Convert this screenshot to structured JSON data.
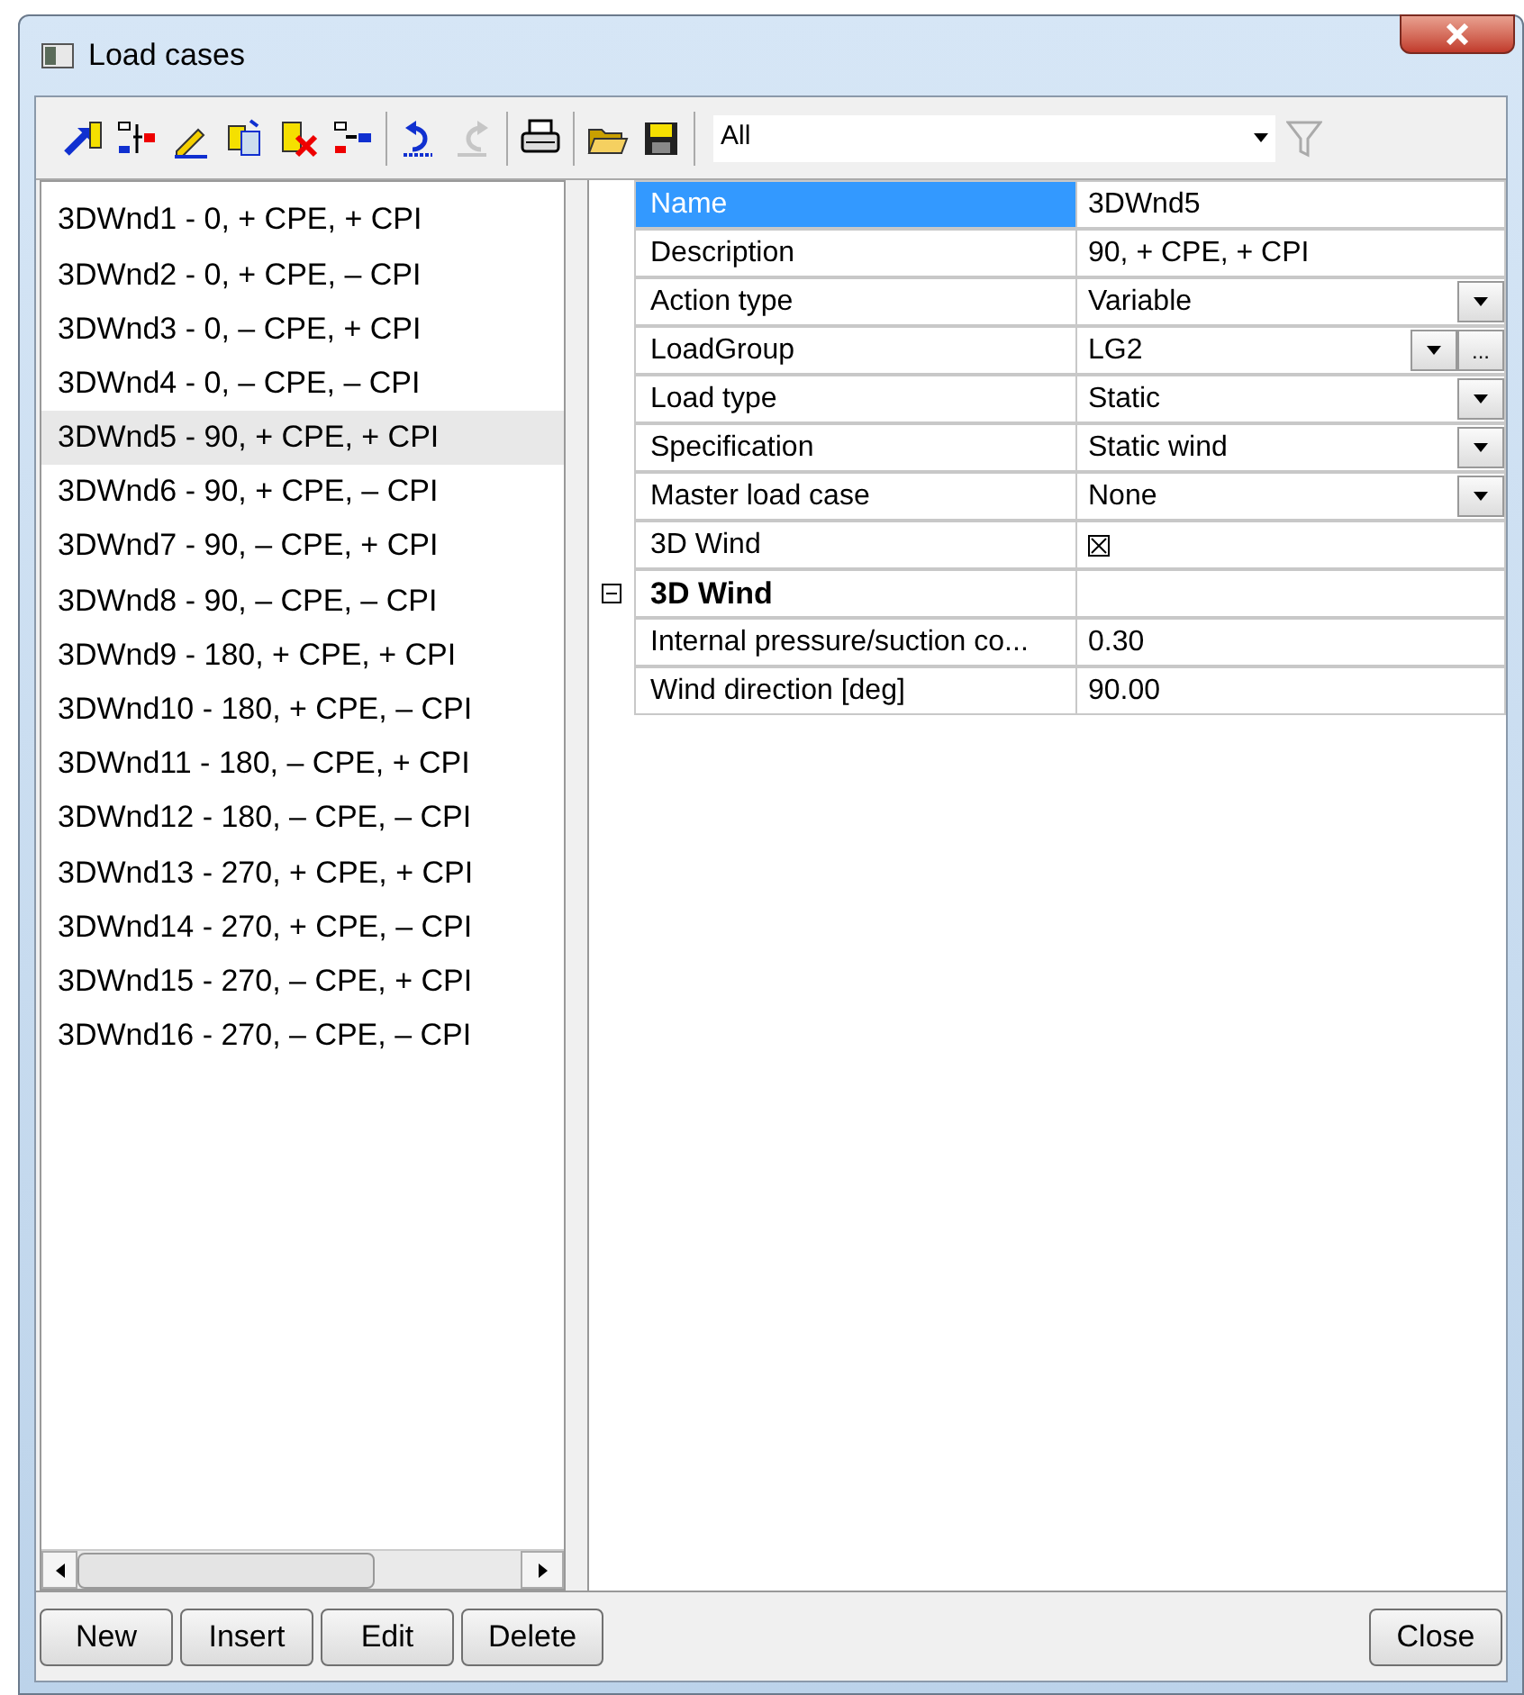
{
  "window": {
    "title": "Load cases"
  },
  "toolbar": {
    "filter": {
      "value": "All"
    },
    "filter_button": {
      "disabled": true
    },
    "undo": {
      "disabled": false
    },
    "redo": {
      "disabled": true
    }
  },
  "load_cases": [
    {
      "label": "3DWnd1 - 0, + CPE, + CPI",
      "selected": false
    },
    {
      "label": "3DWnd2 - 0, + CPE, – CPI",
      "selected": false
    },
    {
      "label": "3DWnd3 - 0, – CPE, + CPI",
      "selected": false
    },
    {
      "label": "3DWnd4 - 0, – CPE, – CPI",
      "selected": false
    },
    {
      "label": "3DWnd5 - 90, + CPE, + CPI",
      "selected": true
    },
    {
      "label": "3DWnd6 - 90, + CPE, – CPI",
      "selected": false
    },
    {
      "label": "3DWnd7 - 90, – CPE, + CPI",
      "selected": false
    },
    {
      "label": "3DWnd8 - 90, – CPE, – CPI",
      "selected": false
    },
    {
      "label": "3DWnd9 - 180, + CPE, + CPI",
      "selected": false
    },
    {
      "label": "3DWnd10 - 180, + CPE, – CPI",
      "selected": false
    },
    {
      "label": "3DWnd11 - 180, – CPE, + CPI",
      "selected": false
    },
    {
      "label": "3DWnd12 - 180, – CPE, – CPI",
      "selected": false
    },
    {
      "label": "3DWnd13 - 270, + CPE, + CPI",
      "selected": false
    },
    {
      "label": "3DWnd14 - 270, + CPE, – CPI",
      "selected": false
    },
    {
      "label": "3DWnd15 - 270, – CPE, + CPI",
      "selected": false
    },
    {
      "label": "3DWnd16 - 270, – CPE, – CPI",
      "selected": false
    }
  ],
  "properties": [
    {
      "kind": "text",
      "name": "Name",
      "value": "3DWnd5",
      "selected": true
    },
    {
      "kind": "text",
      "name": "Description",
      "value": "90, + CPE, + CPI",
      "selected": false
    },
    {
      "kind": "dropdown",
      "name": "Action type",
      "value": "Variable",
      "selected": false
    },
    {
      "kind": "dropdown_ellipsis",
      "name": "LoadGroup",
      "value": "LG2",
      "button_text": "...",
      "selected": false
    },
    {
      "kind": "dropdown",
      "name": "Load type",
      "value": "Static",
      "selected": false
    },
    {
      "kind": "dropdown",
      "name": "Specification",
      "value": "Static wind",
      "selected": false
    },
    {
      "kind": "dropdown",
      "name": "Master load case",
      "value": "None",
      "selected": false
    },
    {
      "kind": "checkbox",
      "name": "3D Wind",
      "checked": true,
      "selected": false
    },
    {
      "kind": "category",
      "name": "3D Wind",
      "expanded": true,
      "selected": false
    },
    {
      "kind": "text",
      "name": "Internal pressure/suction co...",
      "value": "0.30",
      "selected": false
    },
    {
      "kind": "text",
      "name": "Wind direction [deg]",
      "value": "90.00",
      "selected": false
    }
  ],
  "buttons": {
    "left": [
      "New",
      "Insert",
      "Edit",
      "Delete"
    ],
    "right": [
      "Close"
    ]
  }
}
